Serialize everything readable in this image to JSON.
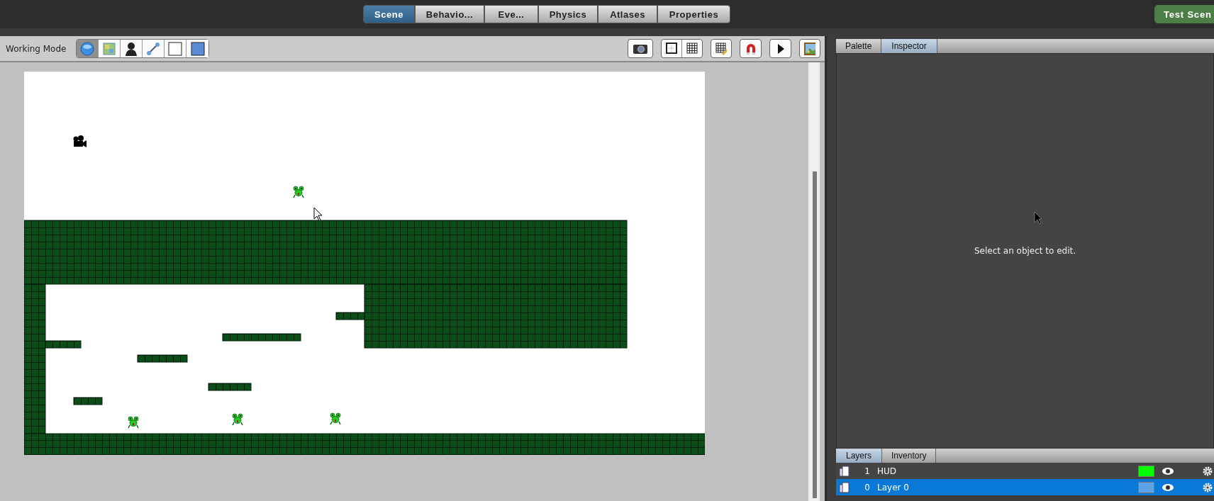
{
  "top_tabs": [
    {
      "label": "Scene",
      "selected": true
    },
    {
      "label": "Behavio...",
      "selected": false
    },
    {
      "label": "Eve...",
      "selected": false
    },
    {
      "label": "Physics",
      "selected": false
    },
    {
      "label": "Atlases",
      "selected": false
    },
    {
      "label": "Properties",
      "selected": false
    }
  ],
  "test_button": "Test Scen",
  "working_mode": {
    "label": "Working Mode",
    "tools": [
      {
        "kind": "select",
        "selected": true
      },
      {
        "kind": "terrain",
        "selected": false
      },
      {
        "kind": "actor",
        "selected": false
      },
      {
        "kind": "joint",
        "selected": false
      },
      {
        "kind": "region",
        "selected": false
      },
      {
        "kind": "fill",
        "selected": false
      }
    ]
  },
  "side_tabs": [
    {
      "label": "Palette",
      "selected": false
    },
    {
      "label": "Inspector",
      "selected": true
    }
  ],
  "inspector_message": "Select an object to edit.",
  "bottom_tabs": [
    {
      "label": "Layers",
      "selected": true
    },
    {
      "label": "Inventory",
      "selected": false
    }
  ],
  "layers": [
    {
      "number": "1",
      "name": "HUD",
      "color": "#00ff00",
      "selected": false
    },
    {
      "number": "0",
      "name": "Layer 0",
      "color": "#5ea3e6",
      "selected": true
    }
  ]
}
